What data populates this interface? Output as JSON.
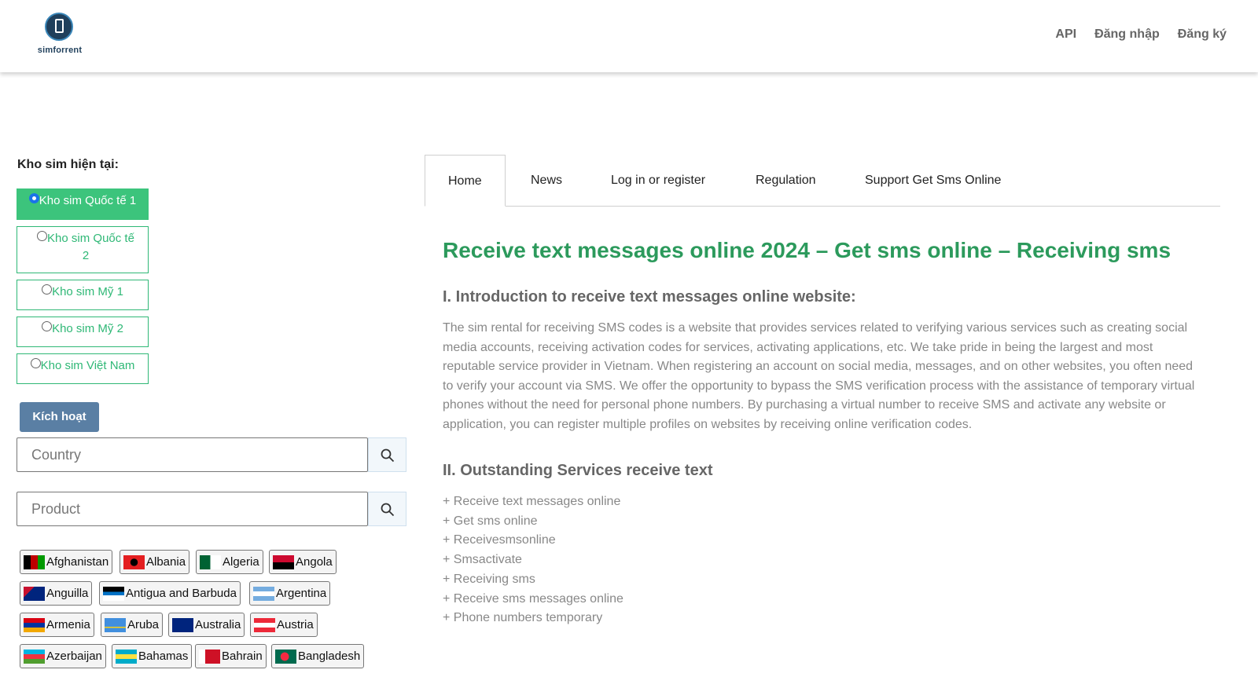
{
  "header": {
    "logo_text": "simforrent",
    "nav": [
      "API",
      "Đăng nhập",
      "Đăng ký"
    ]
  },
  "sidebar": {
    "title": "Kho sim hiện tại:",
    "sim_options": [
      {
        "label": "Kho sim Quốc tế 1",
        "selected": true
      },
      {
        "label": "Kho sim Quốc tế 2",
        "selected": false
      },
      {
        "label": "Kho sim Mỹ 1",
        "selected": false
      },
      {
        "label": "Kho sim Mỹ 2",
        "selected": false
      },
      {
        "label": "Kho sim Việt Nam",
        "selected": false
      }
    ],
    "activate_label": "Kích hoạt",
    "country_placeholder": "Country",
    "product_placeholder": "Product",
    "countries": [
      "Afghanistan",
      "Albania",
      "Algeria",
      "Angola",
      "Anguilla",
      "Antigua and Barbuda",
      "Argentina",
      "Armenia",
      "Aruba",
      "Australia",
      "Austria",
      "Azerbaijan",
      "Bahamas",
      "Bahrain",
      "Bangladesh"
    ]
  },
  "tabs": [
    "Home",
    "News",
    "Log in or register",
    "Regulation",
    "Support Get Sms Online"
  ],
  "active_tab": "Home",
  "content": {
    "title": "Receive text messages online 2024 – Get sms online – Receiving sms",
    "section1_heading": "I. Introduction to receive text messages online website:",
    "section1_body": "The sim rental for receiving SMS codes is a website that provides services related to verifying various services such as creating social media accounts, receiving activation codes for services, activating applications, etc. We take pride in being the largest and most reputable service provider in Vietnam. When registering an account on social media, messages, and on other websites, you often need to verify your account via SMS. We offer the opportunity to bypass the SMS verification process with the assistance of temporary virtual phones without the need for personal phone numbers. By purchasing a virtual number to receive SMS and activate any website or application, you can register multiple profiles on websites by receiving online verification codes.",
    "section2_heading": "II. Outstanding Services receive text",
    "services": [
      "+ Receive text messages online",
      "+ Get sms online",
      "+ Receivesmsonline",
      "+ Smsactivate",
      "+ Receiving sms",
      "+ Receive sms messages online",
      "+ Phone numbers temporary"
    ]
  },
  "colors": {
    "accent_green": "#2c9a5c",
    "active_green": "#3cc47c",
    "button_blue": "#5a7fa4"
  }
}
